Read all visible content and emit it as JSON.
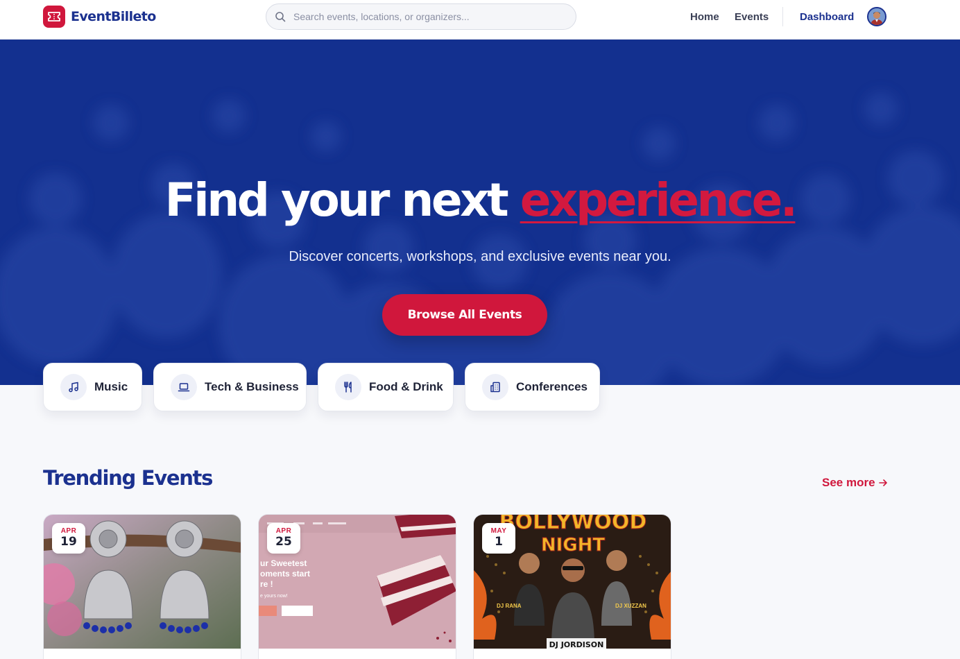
{
  "brand": {
    "name": "EventBilleto",
    "color": "#1b318f",
    "logo_color": "#d0173c",
    "logo_icon": "ticket-icon"
  },
  "search": {
    "placeholder": "Search events, locations, or organizers...",
    "value": "",
    "icon": "search-icon"
  },
  "nav": {
    "home": "Home",
    "events": "Events",
    "dashboard": "Dashboard"
  },
  "hero": {
    "title_main": "Find your next ",
    "title_accent": "experience.",
    "subtitle": "Discover concerts, workshops, and exclusive events near you.",
    "cta": "Browse All Events",
    "background_color": "#13308f",
    "accent_color": "#d3193f"
  },
  "categories": [
    {
      "label": "Music",
      "icon": "music-note-icon"
    },
    {
      "label": "Tech & Business",
      "icon": "laptop-icon"
    },
    {
      "label": "Food & Drink",
      "icon": "utensils-icon"
    },
    {
      "label": "Conferences",
      "icon": "building-icon"
    }
  ],
  "trending": {
    "title": "Trending Events",
    "see_more": "See more",
    "events": [
      {
        "month": "APR",
        "day": "19",
        "image": "silver-jhumka-earrings"
      },
      {
        "month": "APR",
        "day": "25",
        "image": "red-velvet-cake-website",
        "image_text": {
          "line1": "ur Sweetest",
          "line2": "oments start",
          "line3": "re !",
          "line4": "e yours now!"
        }
      },
      {
        "month": "MAY",
        "day": "1",
        "image": "bollywood-night-poster",
        "image_text": {
          "headline": "BOLLYWOOD",
          "headline2": "NIGHT",
          "dj_left": "DJ RANA",
          "dj_right": "DJ XUZZAN",
          "dj_bottom": "DJ JORDISON"
        }
      }
    ]
  }
}
